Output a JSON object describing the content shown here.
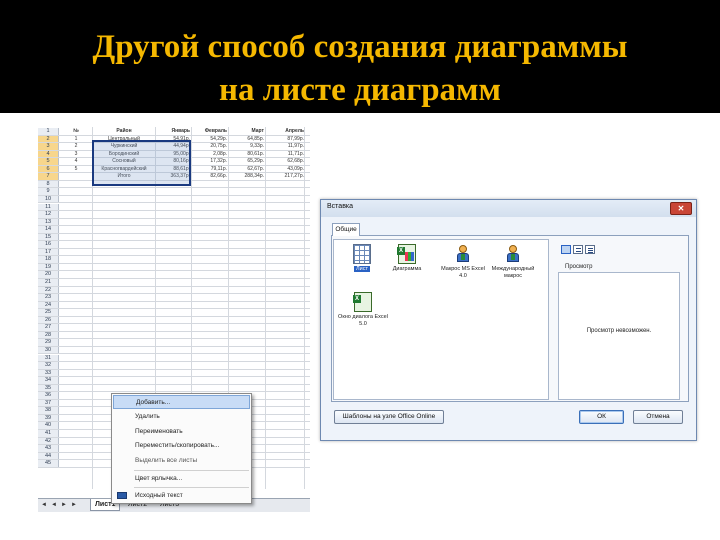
{
  "slide": {
    "title_line1": "Другой способ создания диаграммы",
    "title_line2": "на листе диаграмм",
    "colors": {
      "title_band": "#000000",
      "title_text": "#f5b800"
    }
  },
  "spreadsheet": {
    "header": [
      "№",
      "Район",
      "Январь",
      "Февраль",
      "Март",
      "Апрель"
    ],
    "rows": [
      [
        "1",
        "Центральный",
        "54,91р.",
        "54,29р.",
        "64,85р.",
        "87,99р."
      ],
      [
        "2",
        "Чуркинский",
        "44,94р.",
        "20,75р.",
        "9,33р.",
        "11,97р."
      ],
      [
        "3",
        "Бородинский",
        "95,00р.",
        "2,08р.",
        "80,61р.",
        "11,71р."
      ],
      [
        "4",
        "Сосновый",
        "80,16р.",
        "17,32р.",
        "65,29р.",
        "62,68р."
      ],
      [
        "5",
        "Красногвардейский",
        "88,61р.",
        "79,11р.",
        "62,67р.",
        "43,09р."
      ],
      [
        "",
        "Итого",
        "363,37р.",
        "82,66р.",
        "288,34р.",
        "217,27р."
      ]
    ],
    "row_numbers": [
      "1",
      "2",
      "3",
      "4",
      "5",
      "6",
      "7",
      "8",
      "9",
      "10",
      "11",
      "12",
      "13",
      "14",
      "15",
      "16",
      "17",
      "18",
      "19",
      "20",
      "21",
      "22",
      "23",
      "24",
      "25",
      "26",
      "27",
      "28",
      "29",
      "30",
      "31",
      "32",
      "33",
      "34",
      "35",
      "36",
      "37",
      "38",
      "39",
      "40",
      "41",
      "42",
      "43",
      "44",
      "45"
    ],
    "tabs": [
      "Лист1",
      "Лист2",
      "Лист3"
    ],
    "tab_nav": [
      "◄",
      "◄",
      "►",
      "►"
    ]
  },
  "context_menu": {
    "items": [
      {
        "label": "Добавить...",
        "highlighted": true
      },
      {
        "label": "Удалить",
        "highlighted": false
      },
      {
        "label": "Переименовать",
        "highlighted": false
      },
      {
        "label": "Переместить/скопировать...",
        "highlighted": false
      },
      {
        "label": "Выделить все листы",
        "highlighted": false
      },
      {
        "label": "Цвет ярлычка...",
        "highlighted": false
      },
      {
        "label": "Исходный текст",
        "highlighted": false
      }
    ]
  },
  "insert_dialog": {
    "title": "Вставка",
    "close_glyph": "✕",
    "tab": "Общие",
    "items": [
      {
        "label": "Лист",
        "icon": "worksheet-icon",
        "selected": true
      },
      {
        "label": "Диаграмма",
        "icon": "chart-sheet-icon",
        "selected": false
      },
      {
        "label": "Макрос MS Excel 4.0",
        "icon": "macro-sheet-icon",
        "selected": false
      },
      {
        "label": "Международный макрос",
        "icon": "intl-macro-icon",
        "selected": false
      },
      {
        "label": "Окно диалога Excel 5.0",
        "icon": "dialog-sheet-icon",
        "selected": false
      }
    ],
    "preview_label": "Просмотр",
    "preview_text": "Просмотр невозможен.",
    "templates_button": "Шаблоны на узле Office Online",
    "ok_button": "ОК",
    "cancel_button": "Отмена"
  }
}
